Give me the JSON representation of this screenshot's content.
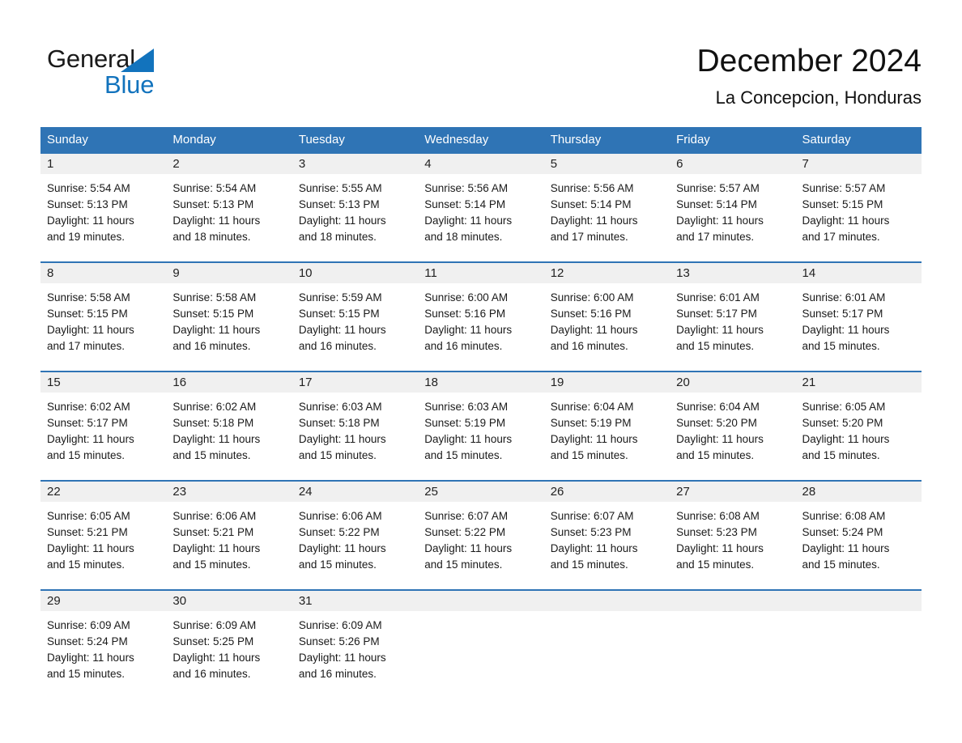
{
  "logo": {
    "word_black": "General",
    "word_blue": "Blue",
    "triangle_color": "#1273bd"
  },
  "header": {
    "title": "December 2024",
    "subtitle": "La Concepcion, Honduras"
  },
  "colors": {
    "header_blue": "#2f74b5",
    "row_band_gray": "#f0f0f0",
    "text": "#1a1a1a",
    "logo_blue": "#1273bd"
  },
  "weekday_headers": [
    "Sunday",
    "Monday",
    "Tuesday",
    "Wednesday",
    "Thursday",
    "Friday",
    "Saturday"
  ],
  "weeks": [
    {
      "days": [
        {
          "num": "1",
          "sunrise": "Sunrise: 5:54 AM",
          "sunset": "Sunset: 5:13 PM",
          "daylight1": "Daylight: 11 hours",
          "daylight2": "and 19 minutes."
        },
        {
          "num": "2",
          "sunrise": "Sunrise: 5:54 AM",
          "sunset": "Sunset: 5:13 PM",
          "daylight1": "Daylight: 11 hours",
          "daylight2": "and 18 minutes."
        },
        {
          "num": "3",
          "sunrise": "Sunrise: 5:55 AM",
          "sunset": "Sunset: 5:13 PM",
          "daylight1": "Daylight: 11 hours",
          "daylight2": "and 18 minutes."
        },
        {
          "num": "4",
          "sunrise": "Sunrise: 5:56 AM",
          "sunset": "Sunset: 5:14 PM",
          "daylight1": "Daylight: 11 hours",
          "daylight2": "and 18 minutes."
        },
        {
          "num": "5",
          "sunrise": "Sunrise: 5:56 AM",
          "sunset": "Sunset: 5:14 PM",
          "daylight1": "Daylight: 11 hours",
          "daylight2": "and 17 minutes."
        },
        {
          "num": "6",
          "sunrise": "Sunrise: 5:57 AM",
          "sunset": "Sunset: 5:14 PM",
          "daylight1": "Daylight: 11 hours",
          "daylight2": "and 17 minutes."
        },
        {
          "num": "7",
          "sunrise": "Sunrise: 5:57 AM",
          "sunset": "Sunset: 5:15 PM",
          "daylight1": "Daylight: 11 hours",
          "daylight2": "and 17 minutes."
        }
      ]
    },
    {
      "days": [
        {
          "num": "8",
          "sunrise": "Sunrise: 5:58 AM",
          "sunset": "Sunset: 5:15 PM",
          "daylight1": "Daylight: 11 hours",
          "daylight2": "and 17 minutes."
        },
        {
          "num": "9",
          "sunrise": "Sunrise: 5:58 AM",
          "sunset": "Sunset: 5:15 PM",
          "daylight1": "Daylight: 11 hours",
          "daylight2": "and 16 minutes."
        },
        {
          "num": "10",
          "sunrise": "Sunrise: 5:59 AM",
          "sunset": "Sunset: 5:15 PM",
          "daylight1": "Daylight: 11 hours",
          "daylight2": "and 16 minutes."
        },
        {
          "num": "11",
          "sunrise": "Sunrise: 6:00 AM",
          "sunset": "Sunset: 5:16 PM",
          "daylight1": "Daylight: 11 hours",
          "daylight2": "and 16 minutes."
        },
        {
          "num": "12",
          "sunrise": "Sunrise: 6:00 AM",
          "sunset": "Sunset: 5:16 PM",
          "daylight1": "Daylight: 11 hours",
          "daylight2": "and 16 minutes."
        },
        {
          "num": "13",
          "sunrise": "Sunrise: 6:01 AM",
          "sunset": "Sunset: 5:17 PM",
          "daylight1": "Daylight: 11 hours",
          "daylight2": "and 15 minutes."
        },
        {
          "num": "14",
          "sunrise": "Sunrise: 6:01 AM",
          "sunset": "Sunset: 5:17 PM",
          "daylight1": "Daylight: 11 hours",
          "daylight2": "and 15 minutes."
        }
      ]
    },
    {
      "days": [
        {
          "num": "15",
          "sunrise": "Sunrise: 6:02 AM",
          "sunset": "Sunset: 5:17 PM",
          "daylight1": "Daylight: 11 hours",
          "daylight2": "and 15 minutes."
        },
        {
          "num": "16",
          "sunrise": "Sunrise: 6:02 AM",
          "sunset": "Sunset: 5:18 PM",
          "daylight1": "Daylight: 11 hours",
          "daylight2": "and 15 minutes."
        },
        {
          "num": "17",
          "sunrise": "Sunrise: 6:03 AM",
          "sunset": "Sunset: 5:18 PM",
          "daylight1": "Daylight: 11 hours",
          "daylight2": "and 15 minutes."
        },
        {
          "num": "18",
          "sunrise": "Sunrise: 6:03 AM",
          "sunset": "Sunset: 5:19 PM",
          "daylight1": "Daylight: 11 hours",
          "daylight2": "and 15 minutes."
        },
        {
          "num": "19",
          "sunrise": "Sunrise: 6:04 AM",
          "sunset": "Sunset: 5:19 PM",
          "daylight1": "Daylight: 11 hours",
          "daylight2": "and 15 minutes."
        },
        {
          "num": "20",
          "sunrise": "Sunrise: 6:04 AM",
          "sunset": "Sunset: 5:20 PM",
          "daylight1": "Daylight: 11 hours",
          "daylight2": "and 15 minutes."
        },
        {
          "num": "21",
          "sunrise": "Sunrise: 6:05 AM",
          "sunset": "Sunset: 5:20 PM",
          "daylight1": "Daylight: 11 hours",
          "daylight2": "and 15 minutes."
        }
      ]
    },
    {
      "days": [
        {
          "num": "22",
          "sunrise": "Sunrise: 6:05 AM",
          "sunset": "Sunset: 5:21 PM",
          "daylight1": "Daylight: 11 hours",
          "daylight2": "and 15 minutes."
        },
        {
          "num": "23",
          "sunrise": "Sunrise: 6:06 AM",
          "sunset": "Sunset: 5:21 PM",
          "daylight1": "Daylight: 11 hours",
          "daylight2": "and 15 minutes."
        },
        {
          "num": "24",
          "sunrise": "Sunrise: 6:06 AM",
          "sunset": "Sunset: 5:22 PM",
          "daylight1": "Daylight: 11 hours",
          "daylight2": "and 15 minutes."
        },
        {
          "num": "25",
          "sunrise": "Sunrise: 6:07 AM",
          "sunset": "Sunset: 5:22 PM",
          "daylight1": "Daylight: 11 hours",
          "daylight2": "and 15 minutes."
        },
        {
          "num": "26",
          "sunrise": "Sunrise: 6:07 AM",
          "sunset": "Sunset: 5:23 PM",
          "daylight1": "Daylight: 11 hours",
          "daylight2": "and 15 minutes."
        },
        {
          "num": "27",
          "sunrise": "Sunrise: 6:08 AM",
          "sunset": "Sunset: 5:23 PM",
          "daylight1": "Daylight: 11 hours",
          "daylight2": "and 15 minutes."
        },
        {
          "num": "28",
          "sunrise": "Sunrise: 6:08 AM",
          "sunset": "Sunset: 5:24 PM",
          "daylight1": "Daylight: 11 hours",
          "daylight2": "and 15 minutes."
        }
      ]
    },
    {
      "days": [
        {
          "num": "29",
          "sunrise": "Sunrise: 6:09 AM",
          "sunset": "Sunset: 5:24 PM",
          "daylight1": "Daylight: 11 hours",
          "daylight2": "and 15 minutes."
        },
        {
          "num": "30",
          "sunrise": "Sunrise: 6:09 AM",
          "sunset": "Sunset: 5:25 PM",
          "daylight1": "Daylight: 11 hours",
          "daylight2": "and 16 minutes."
        },
        {
          "num": "31",
          "sunrise": "Sunrise: 6:09 AM",
          "sunset": "Sunset: 5:26 PM",
          "daylight1": "Daylight: 11 hours",
          "daylight2": "and 16 minutes."
        },
        {
          "num": "",
          "sunrise": "",
          "sunset": "",
          "daylight1": "",
          "daylight2": ""
        },
        {
          "num": "",
          "sunrise": "",
          "sunset": "",
          "daylight1": "",
          "daylight2": ""
        },
        {
          "num": "",
          "sunrise": "",
          "sunset": "",
          "daylight1": "",
          "daylight2": ""
        },
        {
          "num": "",
          "sunrise": "",
          "sunset": "",
          "daylight1": "",
          "daylight2": ""
        }
      ]
    }
  ]
}
